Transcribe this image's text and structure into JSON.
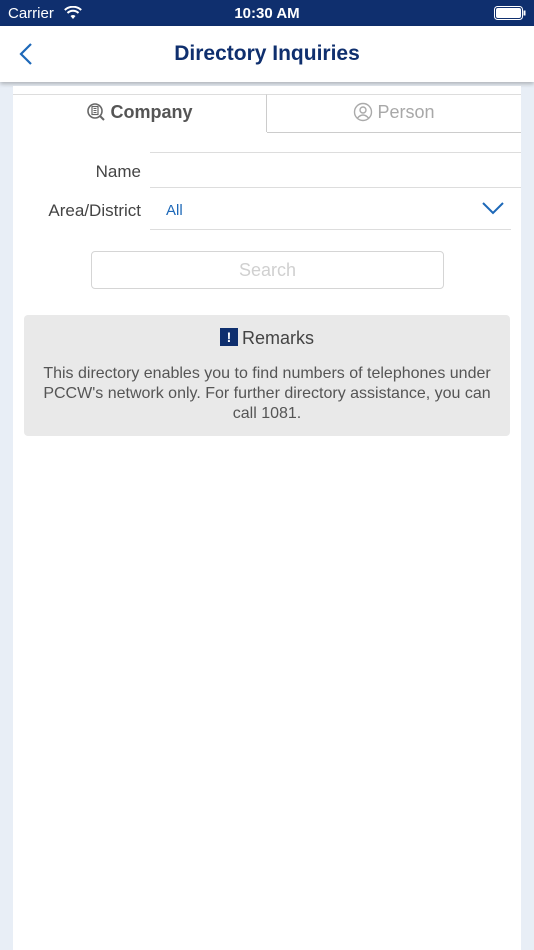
{
  "status_bar": {
    "carrier": "Carrier",
    "time": "10:30 AM"
  },
  "nav": {
    "title": "Directory Inquiries",
    "back_icon": "chevron-left-icon"
  },
  "tabs": [
    {
      "label": "Company",
      "icon": "building-search-icon",
      "selected": true
    },
    {
      "label": "Person",
      "icon": "person-icon",
      "selected": false
    }
  ],
  "form": {
    "name_label": "Name",
    "name_value": "",
    "area_label": "Area/District",
    "area_value": "All",
    "search_label": "Search"
  },
  "remarks": {
    "title": "Remarks",
    "icon": "!",
    "body": "This directory enables you to find numbers of telephones under PCCW's network only. For further directory assistance, you can call 1081."
  },
  "colors": {
    "brand": "#0f2f6e",
    "accent": "#1d68b8",
    "background": "#e8eef6"
  }
}
